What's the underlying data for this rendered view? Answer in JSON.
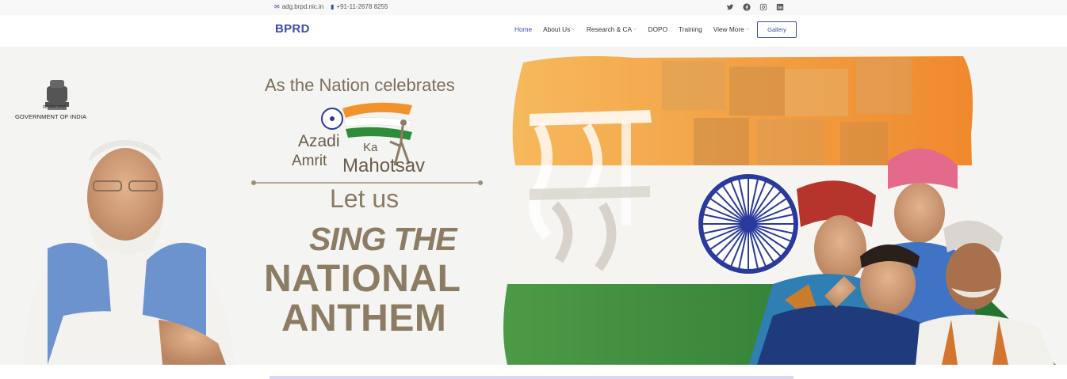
{
  "topbar": {
    "email": "adg.brpd.nic.in",
    "phone": "+91-11-2678 8255",
    "socials": [
      "twitter-icon",
      "facebook-icon",
      "instagram-icon",
      "linkedin-icon"
    ]
  },
  "navbar": {
    "brand": "BPRD",
    "items": [
      {
        "label": "Home",
        "active": true,
        "dropdown": false
      },
      {
        "label": "About Us",
        "active": false,
        "dropdown": true
      },
      {
        "label": "Research & CA",
        "active": false,
        "dropdown": true
      },
      {
        "label": "DOPO",
        "active": false,
        "dropdown": false
      },
      {
        "label": "Training",
        "active": false,
        "dropdown": false
      },
      {
        "label": "View More",
        "active": false,
        "dropdown": true
      }
    ],
    "gallery_label": "Gallery"
  },
  "hero": {
    "emblem_motto": "सत्यमेव जयते",
    "gov_label": "GOVERNMENT OF INDIA",
    "line1": "As the Nation celebrates",
    "logo_azadi": "Azadi",
    "logo_ka": "Ka",
    "logo_amrit": "Amrit",
    "logo_mahotsav": "Mahotsav",
    "line_letus": "Let us",
    "line_sing": "SING THE",
    "line_national": "NATIONAL",
    "line_anthem": "ANTHEM"
  },
  "colors": {
    "brand": "#3e4ca9",
    "saffron": "#f2922b",
    "green": "#2f8c3a",
    "chakra": "#2a3a9c",
    "banner_text": "#8c7c63"
  }
}
